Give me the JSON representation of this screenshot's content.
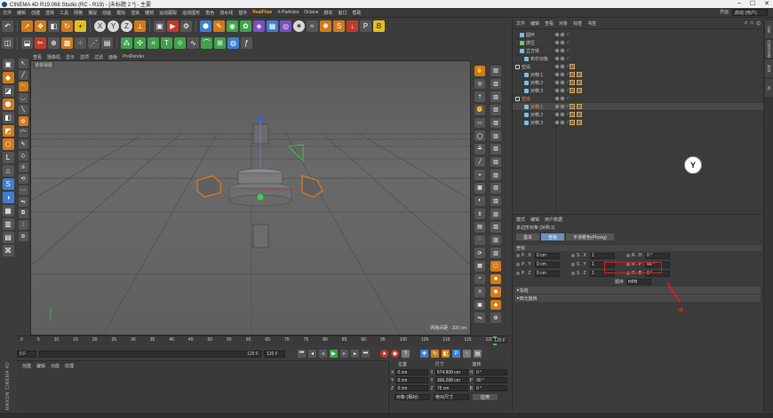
{
  "window": {
    "title": "CINEMA 4D R19.068 Studio (RC - R19) - [未标题 2 *] - 主要"
  },
  "menubar": {
    "items": [
      "文件",
      "编辑",
      "创建",
      "选择",
      "工具",
      "网格",
      "捕捉",
      "动画",
      "模拟",
      "渲染",
      "雕刻",
      "运动跟踪",
      "运动图形",
      "角色",
      "流水线",
      "插件",
      "RealFlow",
      "X-Particles",
      "Octane",
      "脚本",
      "窗口",
      "帮助"
    ],
    "highlight_color": "#ff9a3a",
    "layout_label": "界面",
    "layout_value": "启动 (用户)"
  },
  "viewport": {
    "menu": [
      "查看",
      "摄像机",
      "显示",
      "选项",
      "过滤",
      "面板",
      "ProRender"
    ],
    "label": "透视视图",
    "grid_readout": "网格间距 : 100 cm"
  },
  "timeline": {
    "ticks": [
      "0",
      "5",
      "10",
      "15",
      "20",
      "25",
      "30",
      "35",
      "40",
      "45",
      "50",
      "55",
      "60",
      "65",
      "70",
      "75",
      "80",
      "85",
      "90",
      "95",
      "100",
      "105",
      "110",
      "115",
      "120"
    ],
    "end_label": "120 F",
    "current_frame": "0 F",
    "start_field": "0 F",
    "end_field": "120 F",
    "end_field2": "120 F"
  },
  "bottom_panel": {
    "menu": [
      "创建",
      "编辑",
      "功能",
      "纹理"
    ],
    "logo": "MAXON CINEMA 4D"
  },
  "coords": {
    "headers": [
      "位置",
      "尺寸",
      "旋转"
    ],
    "rows": [
      {
        "axis": "X",
        "pos": "0 cm",
        "size_axis": "X",
        "size": "674.909 cm",
        "rot_axis": "H",
        "rot": "0 °"
      },
      {
        "axis": "Y",
        "pos": "0 cm",
        "size_axis": "Y",
        "size": "306.288 cm",
        "rot_axis": "P",
        "rot": "90 °"
      },
      {
        "axis": "Z",
        "pos": "0 cm",
        "size_axis": "Z",
        "size": "75 cm",
        "rot_axis": "B",
        "rot": "0 °"
      }
    ],
    "mode1": "对象 (相对)",
    "mode2": "绝对尺寸",
    "apply": "应用"
  },
  "objects": {
    "menu": [
      "文件",
      "编辑",
      "查看",
      "对象",
      "标签",
      "书签"
    ],
    "rows": [
      {
        "name": "圆环",
        "icon": "blue",
        "indent": 1,
        "tags": 0,
        "selected": false,
        "orange": false
      },
      {
        "name": "挤压",
        "icon": "green",
        "indent": 1,
        "tags": 0,
        "selected": false,
        "orange": false
      },
      {
        "name": "立方体",
        "icon": "blue",
        "indent": 1,
        "tags": 0,
        "selected": false,
        "orange": false
      },
      {
        "name": "布尔对象",
        "icon": "blue",
        "indent": 2,
        "tags": 0,
        "selected": false,
        "orange": false
      },
      {
        "name": "空白",
        "icon": "null",
        "indent": 0,
        "tags": 1,
        "selected": false,
        "orange": false
      },
      {
        "name": "对称.1",
        "icon": "blue",
        "indent": 2,
        "tags": 2,
        "selected": false,
        "orange": false
      },
      {
        "name": "对称.2",
        "icon": "blue",
        "indent": 2,
        "tags": 2,
        "selected": false,
        "orange": false
      },
      {
        "name": "对称.3",
        "icon": "blue",
        "indent": 2,
        "tags": 2,
        "selected": false,
        "orange": false
      },
      {
        "name": "空白",
        "icon": "null",
        "indent": 0,
        "tags": 0,
        "selected": false,
        "orange": true
      },
      {
        "name": "对称.1",
        "icon": "blue",
        "indent": 2,
        "tags": 2,
        "selected": true,
        "orange": true
      },
      {
        "name": "对称.2",
        "icon": "blue",
        "indent": 2,
        "tags": 2,
        "selected": false,
        "orange": false
      },
      {
        "name": "对称.3",
        "icon": "blue",
        "indent": 2,
        "tags": 2,
        "selected": false,
        "orange": false
      }
    ]
  },
  "attributes": {
    "menu": [
      "模式",
      "编辑",
      "用户数据"
    ],
    "title": "多边形对象 [对称.1]",
    "tabs": [
      "基本",
      "坐标",
      "平滑着色(Phong)"
    ],
    "active_tab": "坐标",
    "section": "坐标",
    "rows": [
      {
        "p": "P . X",
        "pv": "0 cm",
        "s": "S . X",
        "sv": "1",
        "r": "R . H",
        "rv": "0 °"
      },
      {
        "p": "P . Y",
        "pv": "0 cm",
        "s": "S . Y",
        "sv": "1",
        "r": "R . P",
        "rv": "90 °"
      },
      {
        "p": "P . Z",
        "pv": "0 cm",
        "s": "S . Z",
        "sv": "1",
        "r": "R . B",
        "rv": "0 °"
      }
    ],
    "order_label": "顺序",
    "order_value": "HPB",
    "collapsed": [
      "冻结",
      "四元旋转"
    ]
  },
  "right_strip": {
    "tabs": [
      "对象",
      "内容浏览器",
      "构造",
      "层"
    ]
  }
}
